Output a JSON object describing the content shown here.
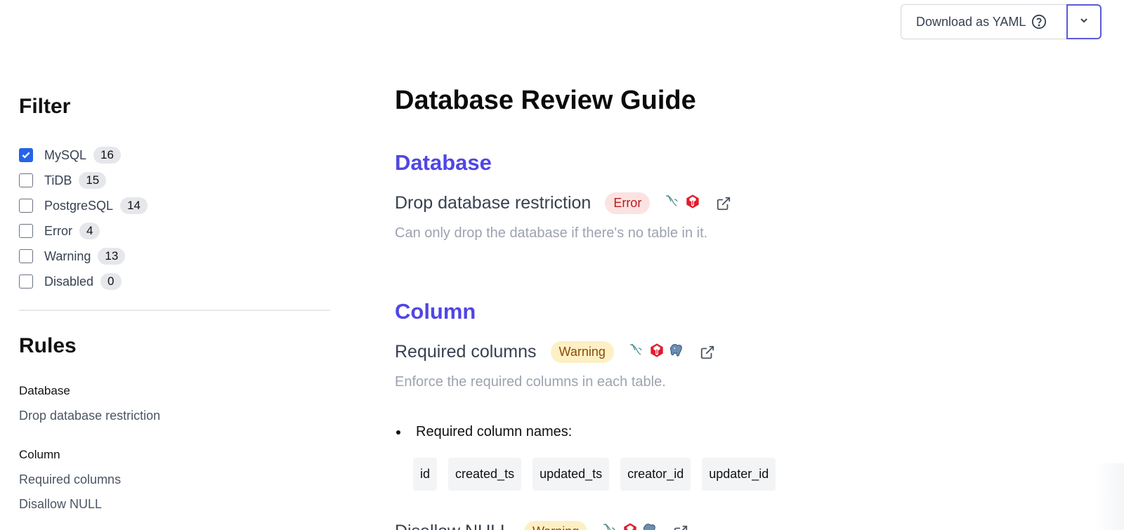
{
  "toolbar": {
    "download_label": "Download as YAML",
    "help_icon": "question-circle-icon",
    "dropdown_icon": "chevron-down-icon"
  },
  "sidebar": {
    "filter_title": "Filter",
    "filters": [
      {
        "label": "MySQL",
        "count": "16",
        "checked": true
      },
      {
        "label": "TiDB",
        "count": "15",
        "checked": false
      },
      {
        "label": "PostgreSQL",
        "count": "14",
        "checked": false
      },
      {
        "label": "Error",
        "count": "4",
        "checked": false
      },
      {
        "label": "Warning",
        "count": "13",
        "checked": false
      },
      {
        "label": "Disabled",
        "count": "0",
        "checked": false
      }
    ],
    "rules_title": "Rules",
    "sections": [
      {
        "name": "Database",
        "items": [
          "Drop database restriction"
        ]
      },
      {
        "name": "Column",
        "items": [
          "Required columns",
          "Disallow NULL"
        ]
      }
    ]
  },
  "main": {
    "title": "Database Review Guide",
    "sections": [
      {
        "name": "Database",
        "rules": [
          {
            "name": "Drop database restriction",
            "level": "Error",
            "engines": [
              "mysql-icon",
              "tidb-icon"
            ],
            "description": "Can only drop the database if there's no table in it."
          }
        ]
      },
      {
        "name": "Column",
        "rules": [
          {
            "name": "Required columns",
            "level": "Warning",
            "engines": [
              "mysql-icon",
              "tidb-icon",
              "postgresql-icon"
            ],
            "description": "Enforce the required columns in each table.",
            "payload_label": "Required column names:",
            "columns": [
              "id",
              "created_ts",
              "updated_ts",
              "creator_id",
              "updater_id"
            ]
          },
          {
            "name": "Disallow NULL",
            "level": "Warning",
            "engines": [
              "mysql-icon",
              "tidb-icon",
              "postgresql-icon"
            ]
          }
        ]
      }
    ]
  },
  "colors": {
    "accent": "#5046e5",
    "error_bg": "#fde2e2",
    "error_text": "#b91c1c",
    "warning_bg": "#fdf0c4",
    "warning_text": "#8a4b0b",
    "checkbox_checked": "#2563eb"
  }
}
